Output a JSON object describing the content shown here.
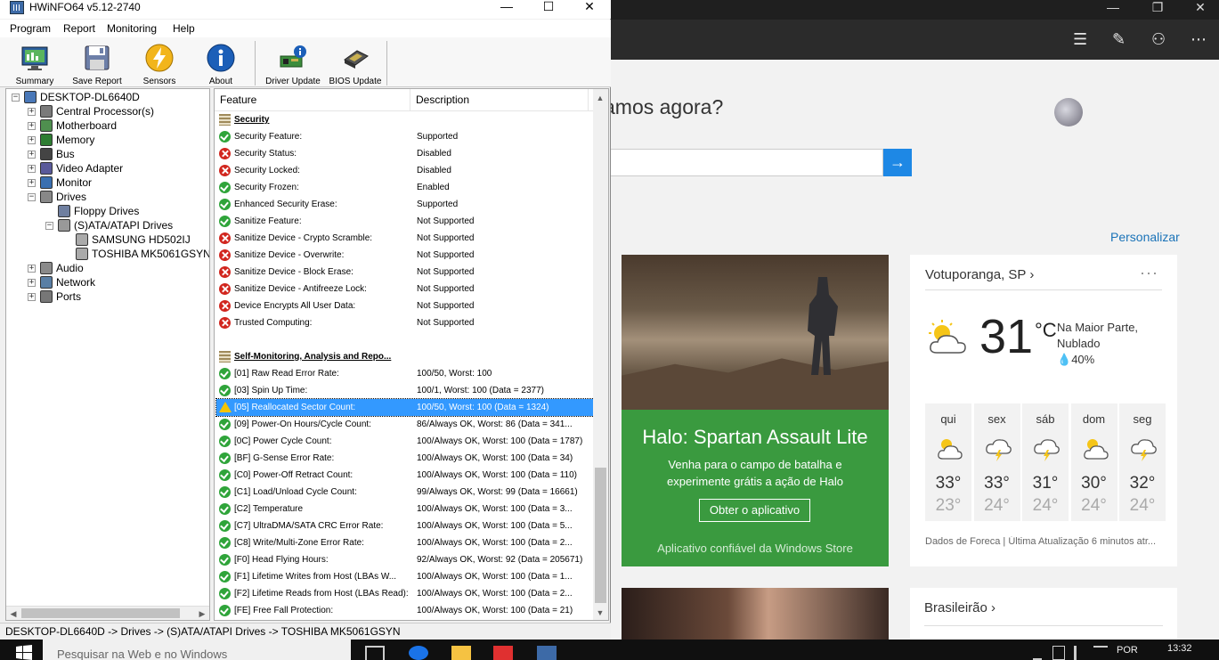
{
  "hwinfo": {
    "title": "HWiNFO64 v5.12-2740",
    "controls": {
      "minimize": "—",
      "maximize": "☐",
      "close": "✕"
    },
    "menu": [
      "Program",
      "Report",
      "Monitoring",
      "Help"
    ],
    "toolbar": [
      "Summary",
      "Save Report",
      "Sensors",
      "About",
      "Driver Update",
      "BIOS Update"
    ],
    "tree": [
      {
        "label": "DESKTOP-DL6640D",
        "icon": "computer-icon",
        "expander": "−"
      },
      {
        "label": "Central Processor(s)",
        "icon": "cpu-icon",
        "expander": "+"
      },
      {
        "label": "Motherboard",
        "icon": "motherboard-icon",
        "expander": "+"
      },
      {
        "label": "Memory",
        "icon": "memory-icon",
        "expander": "+"
      },
      {
        "label": "Bus",
        "icon": "bus-icon",
        "expander": "+"
      },
      {
        "label": "Video Adapter",
        "icon": "video-adapter-icon",
        "expander": "+"
      },
      {
        "label": "Monitor",
        "icon": "monitor-icon",
        "expander": "+"
      },
      {
        "label": "Drives",
        "icon": "drives-icon",
        "expander": "−"
      },
      {
        "label": "Floppy Drives",
        "icon": "floppy-icon",
        "expander": ""
      },
      {
        "label": "(S)ATA/ATAPI Drives",
        "icon": "disk-icon",
        "expander": "−"
      },
      {
        "label": "SAMSUNG HD502IJ",
        "icon": "hard-drive-icon",
        "expander": ""
      },
      {
        "label": "TOSHIBA MK5061GSYN",
        "icon": "hard-drive-icon",
        "expander": ""
      },
      {
        "label": "Audio",
        "icon": "audio-icon",
        "expander": "+"
      },
      {
        "label": "Network",
        "icon": "network-icon",
        "expander": "+"
      },
      {
        "label": "Ports",
        "icon": "ports-icon",
        "expander": "+"
      }
    ],
    "columns": {
      "feature": "Feature",
      "description": "Description"
    },
    "rows": [
      {
        "type": "section",
        "feature": "Security",
        "desc": ""
      },
      {
        "type": "ok",
        "feature": "Security Feature:",
        "desc": "Supported"
      },
      {
        "type": "bad",
        "feature": "Security Status:",
        "desc": "Disabled"
      },
      {
        "type": "bad",
        "feature": "Security Locked:",
        "desc": "Disabled"
      },
      {
        "type": "ok",
        "feature": "Security Frozen:",
        "desc": "Enabled"
      },
      {
        "type": "ok",
        "feature": "Enhanced Security Erase:",
        "desc": "Supported"
      },
      {
        "type": "ok",
        "feature": "Sanitize Feature:",
        "desc": "Not Supported"
      },
      {
        "type": "bad",
        "feature": "Sanitize Device - Crypto Scramble:",
        "desc": "Not Supported"
      },
      {
        "type": "bad",
        "feature": "Sanitize Device - Overwrite:",
        "desc": "Not Supported"
      },
      {
        "type": "bad",
        "feature": "Sanitize Device - Block Erase:",
        "desc": "Not Supported"
      },
      {
        "type": "bad",
        "feature": "Sanitize Device - Antifreeze Lock:",
        "desc": "Not Supported"
      },
      {
        "type": "bad",
        "feature": "Device Encrypts All User Data:",
        "desc": "Not Supported"
      },
      {
        "type": "bad",
        "feature": "Trusted Computing:",
        "desc": "Not Supported"
      },
      {
        "type": "blank",
        "feature": "",
        "desc": ""
      },
      {
        "type": "section",
        "feature": "Self-Monitoring, Analysis and Repo...",
        "desc": ""
      },
      {
        "type": "ok",
        "feature": "[01] Raw Read Error Rate:",
        "desc": "100/50, Worst: 100"
      },
      {
        "type": "ok",
        "feature": "[03] Spin Up Time:",
        "desc": "100/1, Worst: 100 (Data = 2377)"
      },
      {
        "type": "warn",
        "feature": "[05] Reallocated Sector Count:",
        "desc": "100/50, Worst: 100 (Data = 1324)",
        "selected": true
      },
      {
        "type": "ok",
        "feature": "[09] Power-On Hours/Cycle Count:",
        "desc": "86/Always OK, Worst: 86 (Data = 341..."
      },
      {
        "type": "ok",
        "feature": "[0C] Power Cycle Count:",
        "desc": "100/Always OK, Worst: 100 (Data = 1787)"
      },
      {
        "type": "ok",
        "feature": "[BF] G-Sense Error Rate:",
        "desc": "100/Always OK, Worst: 100 (Data = 34)"
      },
      {
        "type": "ok",
        "feature": "[C0] Power-Off Retract Count:",
        "desc": "100/Always OK, Worst: 100 (Data = 110)"
      },
      {
        "type": "ok",
        "feature": "[C1] Load/Unload Cycle Count:",
        "desc": "99/Always OK, Worst: 99 (Data = 16661)"
      },
      {
        "type": "ok",
        "feature": "[C2] Temperature",
        "desc": "100/Always OK, Worst: 100 (Data = 3..."
      },
      {
        "type": "ok",
        "feature": "[C7] UltraDMA/SATA CRC Error Rate:",
        "desc": "100/Always OK, Worst: 100 (Data = 5..."
      },
      {
        "type": "ok",
        "feature": "[C8] Write/Multi-Zone Error Rate:",
        "desc": "100/Always OK, Worst: 100 (Data = 2..."
      },
      {
        "type": "ok",
        "feature": "[F0] Head Flying Hours:",
        "desc": "92/Always OK, Worst: 92 (Data = 205671)"
      },
      {
        "type": "ok",
        "feature": "[F1] Lifetime Writes from Host (LBAs W...",
        "desc": "100/Always OK, Worst: 100 (Data = 1..."
      },
      {
        "type": "ok",
        "feature": "[F2] Lifetime Reads from Host (LBAs Read):",
        "desc": "100/Always OK, Worst: 100 (Data = 2..."
      },
      {
        "type": "ok",
        "feature": "[FE] Free Fall Protection:",
        "desc": "100/Always OK, Worst: 100 (Data = 21)"
      }
    ],
    "status": "DESKTOP-DL6640D -> Drives -> (S)ATA/ATAPI Drives -> TOSHIBA MK5061GSYN"
  },
  "msn": {
    "greeting": "amos agora?",
    "personalize": "Personalizar",
    "ad": {
      "title": "Halo: Spartan Assault Lite",
      "text": "Venha para o campo de batalha e experimente grátis a ação de Halo",
      "button": "Obter o aplicativo",
      "trust": "Aplicativo confiável da Windows Store"
    },
    "weather": {
      "location": "Votuporanga, SP",
      "chevron": "›",
      "more": "···",
      "temp": "31",
      "unit": "°C",
      "condition": "Na Maior Parte, Nublado",
      "rain": "40%",
      "days": [
        {
          "name": "qui",
          "hi": "33°",
          "lo": "23°",
          "icon": "partly-sunny-icon"
        },
        {
          "name": "sex",
          "hi": "33°",
          "lo": "24°",
          "icon": "thunderstorm-icon"
        },
        {
          "name": "sáb",
          "hi": "31°",
          "lo": "24°",
          "icon": "thunderstorm-icon"
        },
        {
          "name": "dom",
          "hi": "30°",
          "lo": "24°",
          "icon": "partly-sunny-icon"
        },
        {
          "name": "seg",
          "hi": "32°",
          "lo": "24°",
          "icon": "thunderstorm-icon"
        }
      ],
      "source": "Dados de Foreca | Última Atualização 6 minutos atr..."
    },
    "news": {
      "title": "Brasileirão",
      "chevron": "›"
    }
  },
  "taskbar": {
    "search_placeholder": "Pesquisar na Web e no Windows",
    "lang": "POR",
    "time": "13:32"
  },
  "colors": {
    "accent": "#1e88e5",
    "ad_green": "#3a9a3f",
    "selection": "#3399ff"
  }
}
